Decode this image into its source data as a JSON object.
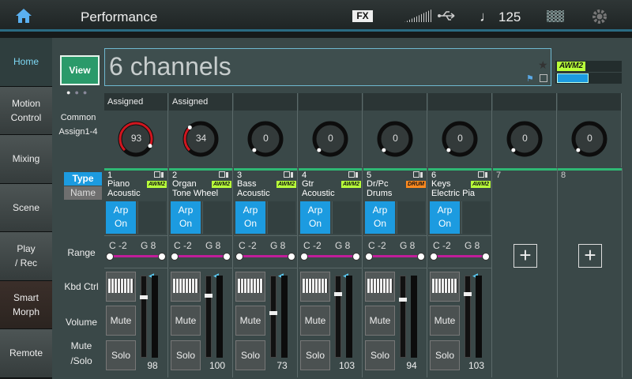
{
  "header": {
    "title": "Performance",
    "fx": "FX",
    "tempo": "125"
  },
  "sidebar": {
    "items": [
      {
        "label": "Home",
        "active": true
      },
      {
        "label": "Motion\nControl"
      },
      {
        "label": "Mixing"
      },
      {
        "label": "Scene"
      },
      {
        "label": "Play\n/ Rec"
      },
      {
        "label": "Smart\nMorph"
      },
      {
        "label": "Remote"
      }
    ]
  },
  "main": {
    "view_label": "View",
    "performance_name": "6 channels",
    "awm_tag": "AWM2",
    "common_label": "Common\nAssign1-4",
    "knobs": [
      {
        "header": "Assigned",
        "value": "93"
      },
      {
        "header": "Assigned",
        "value": "34"
      },
      {
        "header": "",
        "value": "0"
      },
      {
        "header": "",
        "value": "0"
      },
      {
        "header": "",
        "value": "0"
      },
      {
        "header": "",
        "value": "0"
      },
      {
        "header": "",
        "value": "0"
      },
      {
        "header": "",
        "value": "0"
      }
    ],
    "row_labels": {
      "type": "Type",
      "name": "Name",
      "range": "Range",
      "kbd": "Kbd Ctrl",
      "volume": "Volume",
      "mute_solo": "Mute\n/Solo"
    },
    "parts": [
      {
        "num": "1",
        "cat1": "Piano",
        "cat2": "Acoustic",
        "tag": "AWM2",
        "tag_color": "#b8ff3a",
        "arp": "Arp\nOn",
        "lo": "C -2",
        "hi": "G 8",
        "mute": "Mute",
        "solo": "Solo",
        "volume": "98"
      },
      {
        "num": "2",
        "cat1": "Organ",
        "cat2": "Tone Wheel",
        "tag": "AWM2",
        "tag_color": "#b8ff3a",
        "arp": "Arp\nOn",
        "lo": "C -2",
        "hi": "G 8",
        "mute": "Mute",
        "solo": "Solo",
        "volume": "100"
      },
      {
        "num": "3",
        "cat1": "Bass",
        "cat2": "Acoustic",
        "tag": "AWM2",
        "tag_color": "#b8ff3a",
        "arp": "Arp\nOn",
        "lo": "C -2",
        "hi": "G 8",
        "mute": "Mute",
        "solo": "Solo",
        "volume": "73"
      },
      {
        "num": "4",
        "cat1": "Gtr",
        "cat2": "Acoustic",
        "tag": "AWM2",
        "tag_color": "#b8ff3a",
        "arp": "Arp\nOn",
        "lo": "C -2",
        "hi": "G 8",
        "mute": "Mute",
        "solo": "Solo",
        "volume": "103"
      },
      {
        "num": "5",
        "cat1": "Dr/Pc",
        "cat2": "Drums",
        "tag": "DRUM",
        "tag_color": "#ff8a1f",
        "arp": "Arp\nOn",
        "lo": "C -2",
        "hi": "G 8",
        "mute": "Mute",
        "solo": "Solo",
        "volume": "94"
      },
      {
        "num": "6",
        "cat1": "Keys",
        "cat2": "Electric Pia",
        "tag": "AWM2",
        "tag_color": "#b8ff3a",
        "arp": "Arp\nOn",
        "lo": "C -2",
        "hi": "G 8",
        "mute": "Mute",
        "solo": "Solo",
        "volume": "103"
      }
    ],
    "empty_parts": [
      {
        "num": "7"
      },
      {
        "num": "8"
      }
    ],
    "colors": {
      "accent": "#1c9be0",
      "knob_red": "#d0161f",
      "range_bar": "#c01e9a",
      "part_line": "#2fb874"
    }
  }
}
